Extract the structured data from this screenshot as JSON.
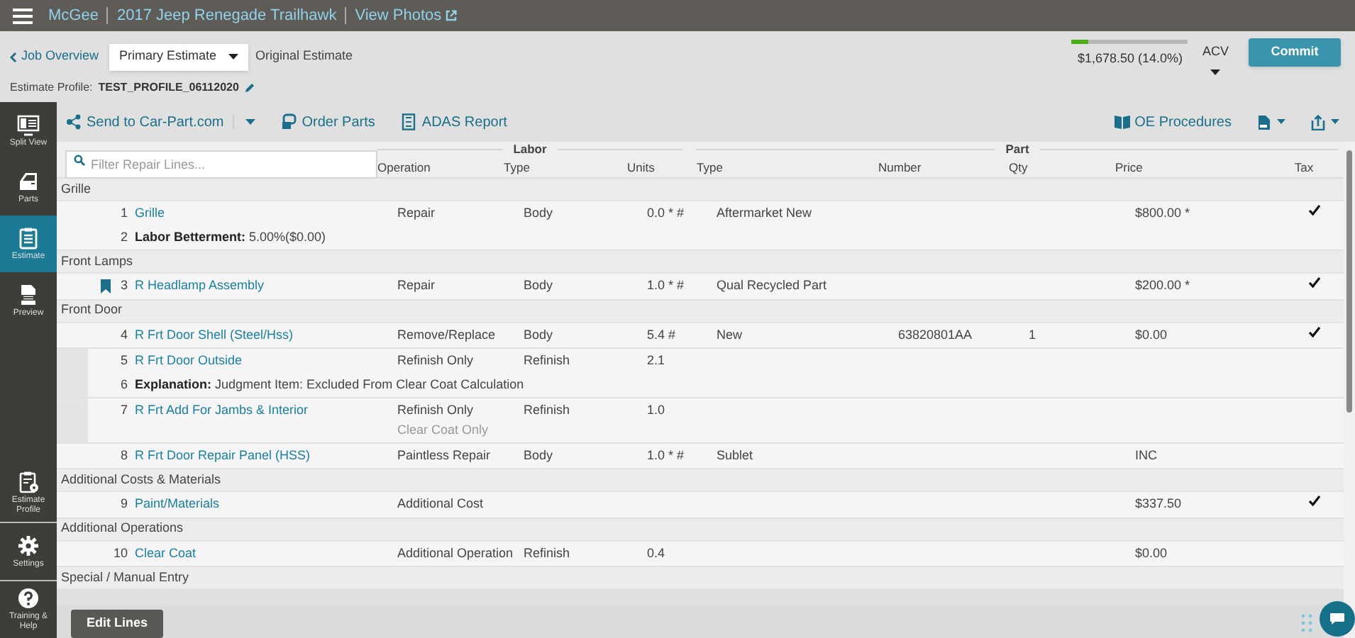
{
  "top_bar": {
    "crumbs": [
      {
        "text": "McGee",
        "external": false
      },
      {
        "text": "2017 Jeep Renegade Trailhawk",
        "external": false
      },
      {
        "text": "View Photos",
        "external": true
      }
    ]
  },
  "header": {
    "back_link": "Job Overview",
    "estimate_select": "Primary Estimate",
    "estimate_label": "Original Estimate",
    "profile_label": "Estimate Profile:",
    "profile_value": "TEST_PROFILE_06112020",
    "total": {
      "level": 0.14,
      "text": "$1,678.50 (14.0%)"
    },
    "valuation": "ACV",
    "commit": "Commit"
  },
  "sidebar": {
    "items": [
      {
        "label": "Split View",
        "selected": false
      },
      {
        "label": "Parts",
        "selected": false
      },
      {
        "label": "Estimate",
        "selected": true
      },
      {
        "label": "Preview",
        "selected": false
      },
      {
        "label": "Estimate Profile",
        "selected": false
      },
      {
        "label": "Settings",
        "selected": false
      },
      {
        "label": "Training & Help",
        "selected": false
      }
    ]
  },
  "toolbar": {
    "left": [
      "Send to Car-Part.com",
      "Order Parts",
      "ADAS Report"
    ],
    "right": [
      "OE Procedures"
    ]
  },
  "table": {
    "filter_placeholder": "Filter Repair Lines...",
    "labor_group": "Labor",
    "part_group": "Part",
    "columns": [
      "Operation",
      "Type",
      "Units",
      "Type",
      "Number",
      "Qty",
      "Price",
      "Tax"
    ],
    "sections": [
      {
        "title": "Grille",
        "rows": [
          {
            "number": "1",
            "description": "Grille",
            "operation": "Repair",
            "labor_type": "Body",
            "units": "0.0 * #",
            "part_type": "Aftermarket New",
            "price": "$800.00 *",
            "taxed": true,
            "bookmarked": false,
            "indented": false,
            "notes": [
              {
                "number": "2",
                "label": "Labor Betterment:",
                "text": "5.00%($0.00)"
              }
            ]
          }
        ]
      },
      {
        "title": "Front Lamps",
        "rows": [
          {
            "number": "3",
            "description": "R Headlamp Assembly",
            "operation": "Repair",
            "labor_type": "Body",
            "units": "1.0 * #",
            "part_type": "Qual Recycled Part",
            "price": "$200.00 *",
            "taxed": true,
            "bookmarked": true,
            "indented": false
          }
        ]
      },
      {
        "title": "Front Door",
        "rows": [
          {
            "number": "4",
            "description": "R Frt Door Shell (Steel/Hss)",
            "operation": "Remove/Replace",
            "labor_type": "Body",
            "units": "5.4 #",
            "part_type": "New",
            "part_number": "63820801AA",
            "qty": "1",
            "price": "$0.00",
            "taxed": true,
            "bookmarked": false,
            "indented": false
          },
          {
            "number": "5",
            "description": "R Frt Door Outside",
            "operation": "Refinish Only",
            "labor_type": "Refinish",
            "units": "2.1",
            "taxed": false,
            "bookmarked": false,
            "indented": true,
            "notes": [
              {
                "number": "6",
                "label": "Explanation:",
                "text": "Judgment Item: Excluded From Clear Coat Calculation"
              }
            ]
          },
          {
            "number": "7",
            "description": "R Frt Add For Jambs & Interior",
            "operation": "Refinish Only",
            "operation_note": "Clear Coat Only",
            "labor_type": "Refinish",
            "units": "1.0",
            "taxed": false,
            "bookmarked": false,
            "indented": true
          },
          {
            "number": "8",
            "description": "R Frt Door Repair Panel (HSS)",
            "operation": "Paintless Repair",
            "labor_type": "Body",
            "units": "1.0 * #",
            "part_type": "Sublet",
            "price": "INC",
            "taxed": false,
            "bookmarked": false,
            "indented": false
          }
        ]
      },
      {
        "title": "Additional Costs & Materials",
        "rows": [
          {
            "number": "9",
            "description": "Paint/Materials",
            "operation": "Additional Cost",
            "price": "$337.50",
            "taxed": true,
            "bookmarked": false,
            "indented": false
          }
        ]
      },
      {
        "title": "Additional Operations",
        "rows": [
          {
            "number": "10",
            "description": "Clear Coat",
            "operation": "Additional Operation",
            "labor_type": "Refinish",
            "units": "0.4",
            "price": "$0.00",
            "taxed": false,
            "bookmarked": false,
            "indented": false
          }
        ]
      },
      {
        "title": "Special / Manual Entry"
      }
    ]
  },
  "footer": {
    "edit_button": "Edit Lines"
  }
}
